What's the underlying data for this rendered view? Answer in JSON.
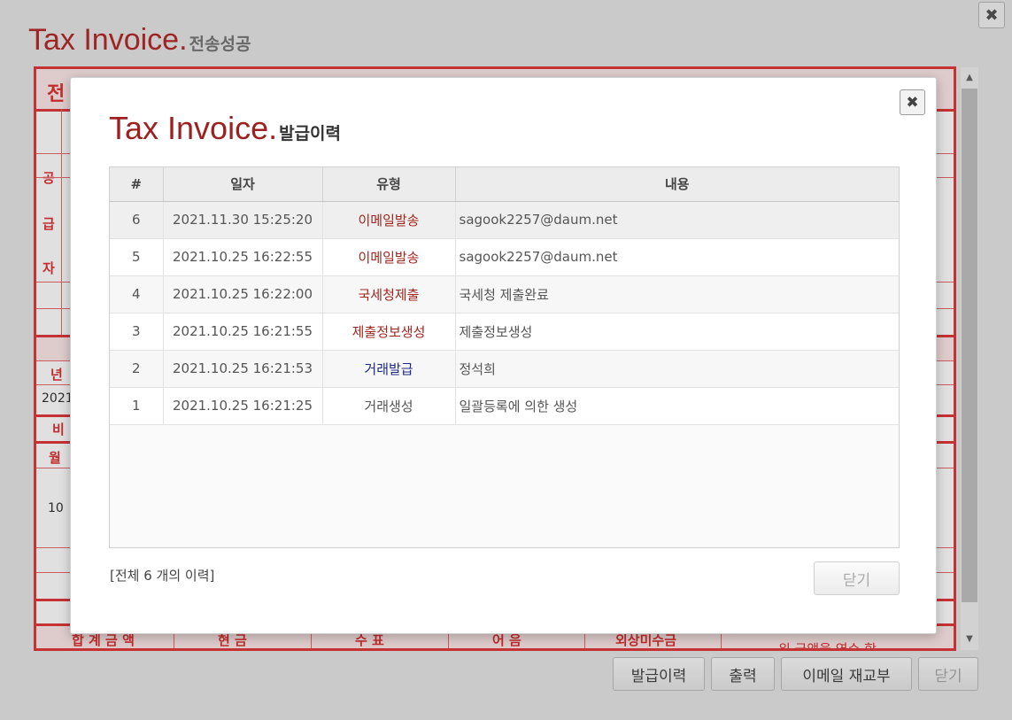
{
  "page": {
    "title": "Tax Invoice.",
    "subtitle": "전송성공",
    "sheet_labels": {
      "header_char": "전",
      "supplier": [
        "공",
        "급",
        "자"
      ],
      "year_label": "년",
      "year_value": "2021",
      "remarks_label": "비",
      "month_label": "월",
      "month_value": "10",
      "footer": [
        "합 계 금 액",
        "현    금",
        "수    표",
        "어    음",
        "외상미수금"
      ],
      "footer_note": "위 금액을 영수 함"
    },
    "buttons": {
      "history": "발급이력",
      "print": "출력",
      "email_resend": "이메일 재교부",
      "close": "닫기"
    }
  },
  "modal": {
    "title": "Tax Invoice.",
    "subtitle": "발급이력",
    "columns": [
      "#",
      "일자",
      "유형",
      "내용"
    ],
    "rows": [
      {
        "no": "6",
        "date": "2021.11.30 15:25:20",
        "type": "이메일발송",
        "content": "sagook2257@daum.net",
        "type_color": "#a0261d"
      },
      {
        "no": "5",
        "date": "2021.10.25 16:22:55",
        "type": "이메일발송",
        "content": "sagook2257@daum.net",
        "type_color": "#a0261d"
      },
      {
        "no": "4",
        "date": "2021.10.25 16:22:00",
        "type": "국세청제출",
        "content": "국세청 제출완료",
        "type_color": "#a0261d"
      },
      {
        "no": "3",
        "date": "2021.10.25 16:21:55",
        "type": "제출정보생성",
        "content": "제출정보생성",
        "type_color": "#a0261d"
      },
      {
        "no": "2",
        "date": "2021.10.25 16:21:53",
        "type": "거래발급",
        "content": "정석희",
        "type_color": "#1d2a8a"
      },
      {
        "no": "1",
        "date": "2021.10.25 16:21:25",
        "type": "거래생성",
        "content": "일괄등록에 의한 생성",
        "type_color": "#555555"
      }
    ],
    "summary": "[전체 6 개의 이력]",
    "close_button": "닫기"
  },
  "icons": {
    "close": "close-icon",
    "scroll_up": "scroll-up-icon",
    "scroll_down": "scroll-down-icon"
  },
  "colors": {
    "title_red": "#b52a2a",
    "sheet_border": "#e0393b"
  }
}
